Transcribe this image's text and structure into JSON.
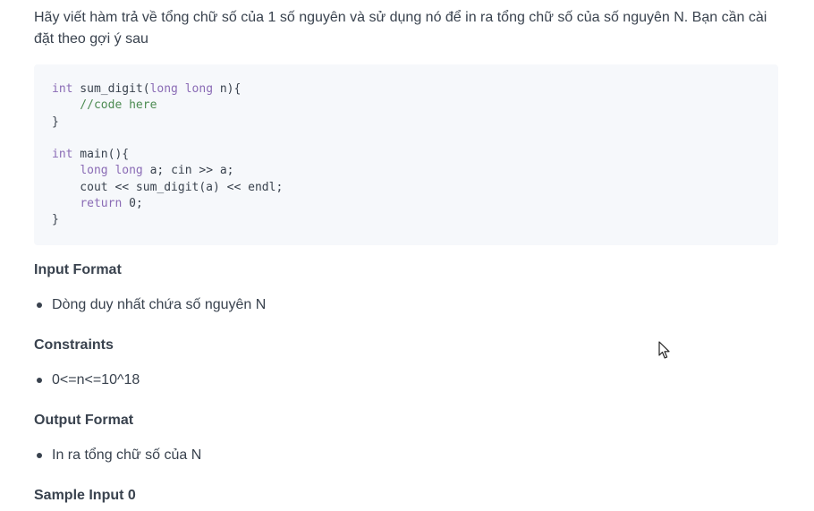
{
  "intro": "Hãy viết hàm trả về tổng chữ số của 1 số nguyên và sử dụng nó để in ra tổng chữ số của số nguyên N. Bạn cần cài đặt theo gợi ý sau",
  "code": {
    "line1_kw1": "int",
    "line1_mid": " sum_digit(",
    "line1_kw2": "long long",
    "line1_end": " n){",
    "line2": "    //code here",
    "line3": "}",
    "line5_kw": "int",
    "line5_end": " main(){",
    "line6_indent": "    ",
    "line6_kw": "long long",
    "line6_end": " a; cin >> a;",
    "line7": "    cout << sum_digit(a) << endl;",
    "line8_indent": "    ",
    "line8_kw": "return",
    "line8_end": " 0;",
    "line9": "}"
  },
  "sections": {
    "input_title": "Input Format",
    "input_item": "Dòng duy nhất chứa số nguyên N",
    "constraints_title": "Constraints",
    "constraints_item": "0<=n<=10^18",
    "output_title": "Output Format",
    "output_item": "In ra tổng chữ số của N",
    "sample_title": "Sample Input 0"
  },
  "icons": {
    "cursor": "mouse-pointer-icon"
  }
}
